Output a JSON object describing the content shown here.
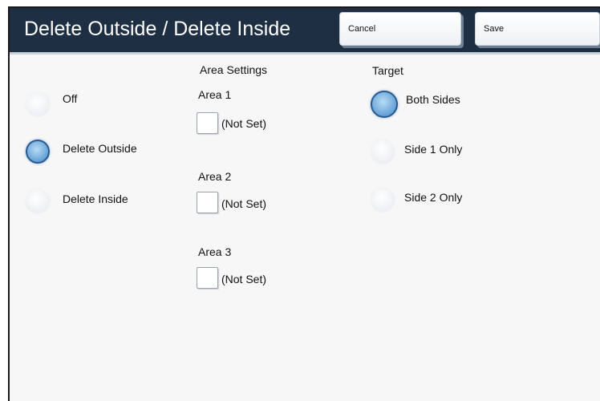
{
  "header": {
    "title": "Delete Outside / Delete Inside",
    "cancel_label": "Cancel",
    "save_label": "Save"
  },
  "mode": {
    "options": [
      {
        "label": "Off",
        "selected": false
      },
      {
        "label": "Delete Outside",
        "selected": true
      },
      {
        "label": "Delete Inside",
        "selected": false
      }
    ]
  },
  "area_settings": {
    "heading": "Area Settings",
    "areas": [
      {
        "label": "Area 1",
        "status": "(Not Set)"
      },
      {
        "label": "Area 2",
        "status": "(Not Set)"
      },
      {
        "label": "Area 3",
        "status": "(Not Set)"
      }
    ]
  },
  "target": {
    "heading": "Target",
    "options": [
      {
        "label": "Both Sides",
        "selected": true
      },
      {
        "label": "Side 1 Only",
        "selected": false
      },
      {
        "label": "Side 2 Only",
        "selected": false
      }
    ]
  },
  "colors": {
    "titlebar_bg": "#1e2f44",
    "selected_radio": "#6aa6d8"
  }
}
